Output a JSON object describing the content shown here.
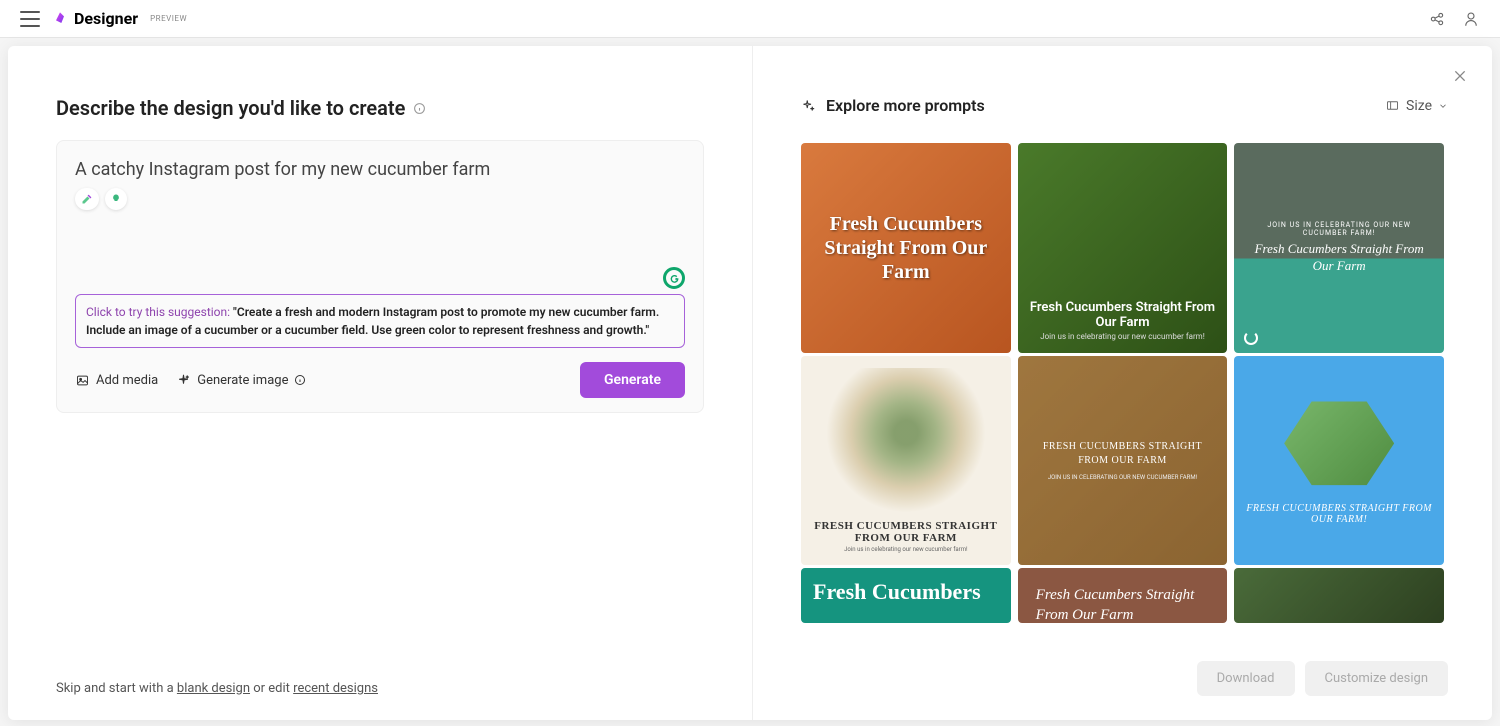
{
  "header": {
    "app_name": "Designer",
    "preview_label": "PREVIEW"
  },
  "left": {
    "title": "Describe the design you'd like to create",
    "prompt_value": "A catchy Instagram post for my new cucumber farm",
    "suggestion_prefix": "Click to try this suggestion: ",
    "suggestion_body": "\"Create a fresh and modern Instagram post to promote my new cucumber farm. Include an image of a cucumber or a cucumber field. Use green color to represent freshness and growth.\"",
    "add_media_label": "Add media",
    "generate_image_label": "Generate image",
    "generate_button": "Generate",
    "skip_pre": "Skip and start with a ",
    "skip_blank": "blank design",
    "skip_mid": " or edit ",
    "skip_recent": "recent designs"
  },
  "right": {
    "explore_label": "Explore more prompts",
    "size_label": "Size",
    "download_label": "Download",
    "customize_label": "Customize design",
    "thumbs": {
      "t1_title": "Fresh Cucumbers Straight From Our Farm",
      "t2_title": "Fresh Cucumbers Straight From Our Farm",
      "t2_sub": "Join us in celebrating our new cucumber farm!",
      "t3_pre": "JOIN US IN CELEBRATING OUR NEW CUCUMBER FARM!",
      "t3_title": "Fresh Cucumbers Straight From Our Farm",
      "t4_title": "FRESH CUCUMBERS STRAIGHT FROM OUR FARM",
      "t4_sub": "Join us in celebrating our new cucumber farm!",
      "t5_title": "FRESH CUCUMBERS STRAIGHT FROM OUR FARM",
      "t5_sub": "JOIN US IN CELEBRATING OUR NEW CUCUMBER FARM!",
      "t6_title": "FRESH CUCUMBERS STRAIGHT FROM OUR FARM!",
      "t7_title": "Fresh Cucumbers",
      "t8_title": "Fresh Cucumbers Straight From Our Farm"
    }
  }
}
